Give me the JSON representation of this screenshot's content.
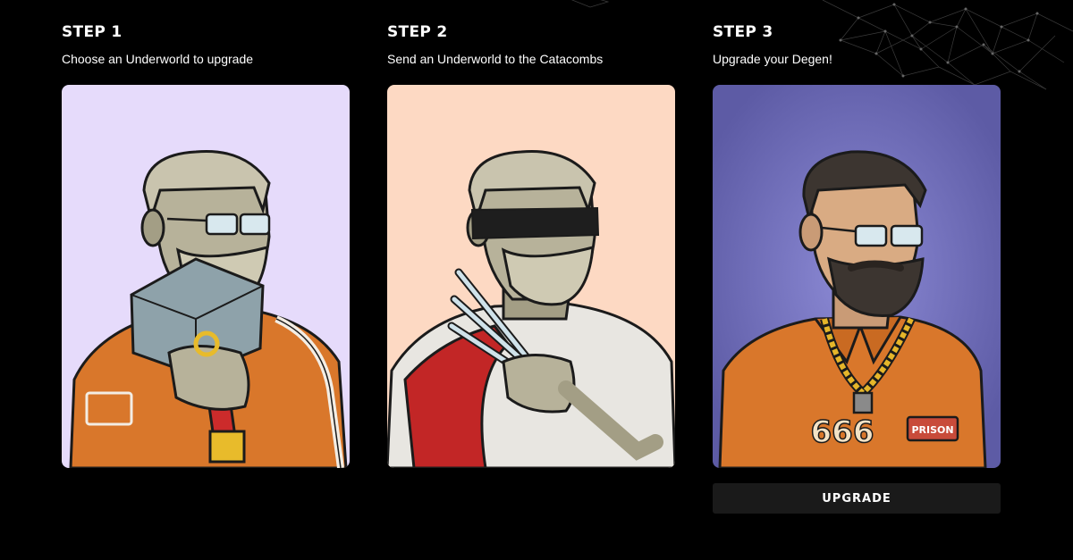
{
  "steps": [
    {
      "title": "STEP 1",
      "description": "Choose an Underworld to upgrade",
      "card_bg": "#e6dbfb"
    },
    {
      "title": "STEP 2",
      "description": "Send an Underworld to the Catacombs",
      "card_bg": "#fdd9c3"
    },
    {
      "title": "STEP 3",
      "description": "Upgrade your Degen!",
      "card_bg": "#6f6db6"
    }
  ],
  "degen_badges": {
    "number": "666",
    "patch": "PRISON"
  },
  "upgrade_button": {
    "label": "UPGRADE"
  },
  "colors": {
    "background": "#000000",
    "text": "#ffffff",
    "button_bg": "#1a1a1a",
    "orange_jumpsuit": "#d9772b",
    "toga_red": "#c22626"
  }
}
